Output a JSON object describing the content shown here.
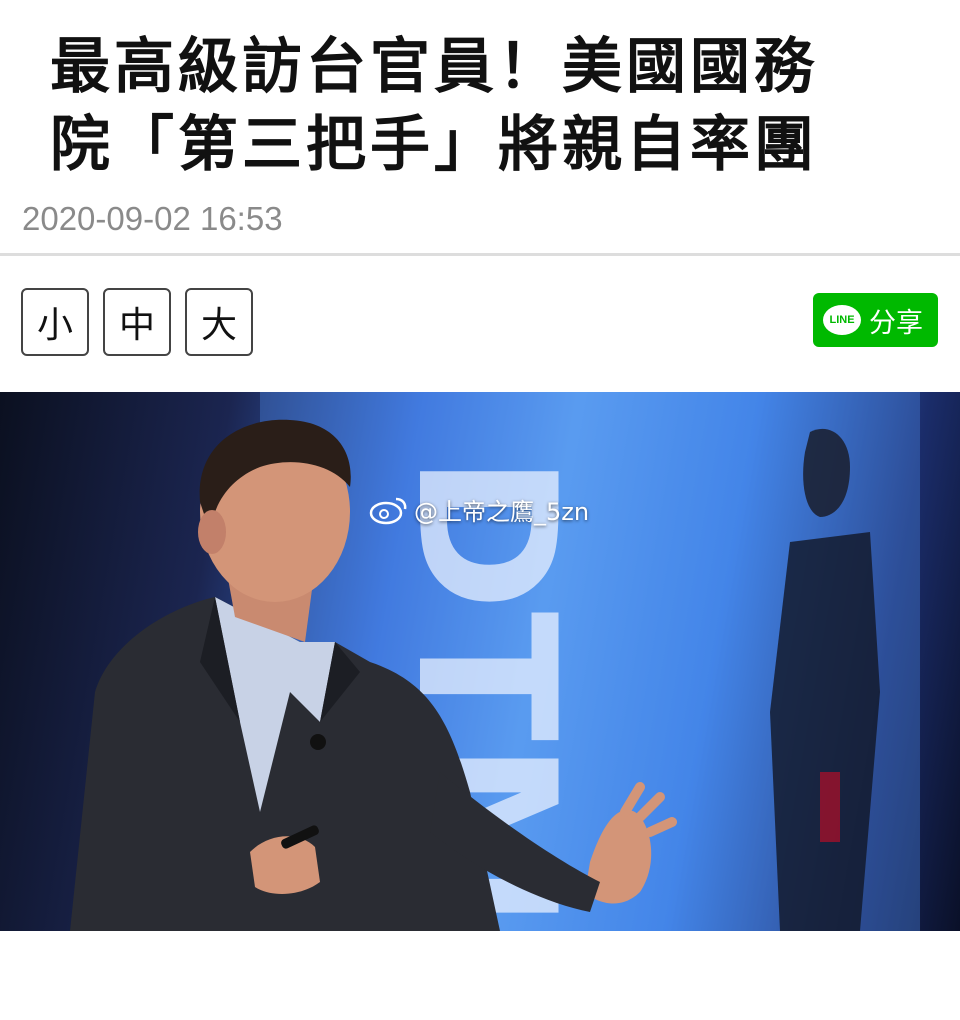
{
  "article": {
    "title_line1": "最高級訪台官員！美國國務",
    "title_line2": "院「第三把手」將親自率團",
    "timestamp": "2020-09-02 16:53"
  },
  "font_size_controls": {
    "small": "小",
    "medium": "中",
    "large": "大"
  },
  "share": {
    "logo_text": "LINE",
    "label": "分享",
    "color": "#00b900"
  },
  "photo": {
    "screen_text": "DTM",
    "watermark": "@上帝之鷹_5zn"
  }
}
